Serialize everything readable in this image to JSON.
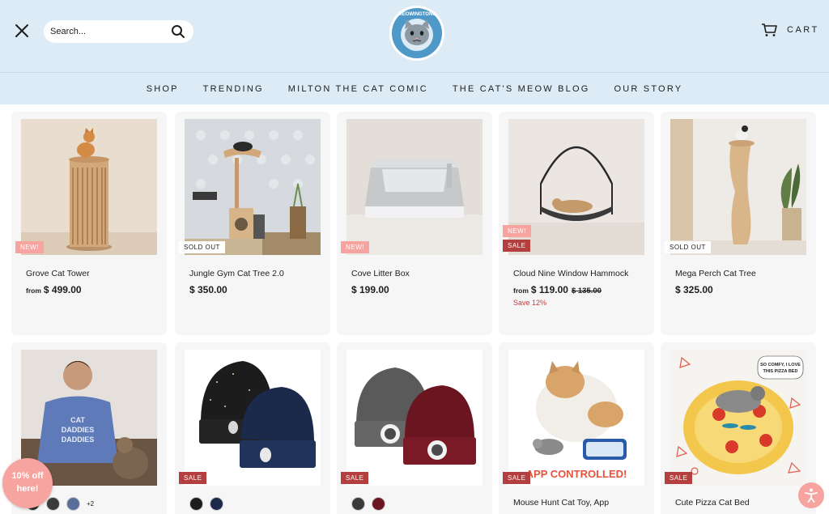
{
  "header": {
    "search_placeholder": "Search...",
    "cart_label": "CART",
    "logo_text": "MEOWINGTONS"
  },
  "nav": {
    "items": [
      "SHOP",
      "TRENDING",
      "MILTON THE CAT COMIC",
      "THE CAT'S MEOW BLOG",
      "OUR STORY"
    ]
  },
  "products": [
    {
      "title": "Grove Cat Tower",
      "from": "from",
      "price": "$ 499.00",
      "badges": [
        "NEW!"
      ]
    },
    {
      "title": "Jungle Gym Cat Tree 2.0",
      "from": "",
      "price": "$ 350.00",
      "badges": [
        "SOLD OUT"
      ]
    },
    {
      "title": "Cove Litter Box",
      "from": "",
      "price": "$ 199.00",
      "badges": [
        "NEW!"
      ]
    },
    {
      "title": "Cloud Nine Window Hammock",
      "from": "from",
      "price": "$ 119.00",
      "compare": "$ 135.00",
      "save": "Save 12%",
      "badges": [
        "NEW!",
        "SALE"
      ]
    },
    {
      "title": "Mega Perch Cat Tree",
      "from": "",
      "price": "$ 325.00",
      "badges": [
        "SOLD OUT"
      ]
    },
    {
      "title": "",
      "badges": [],
      "swatches": [
        "#2a2a2a",
        "#3b3b3b",
        "#5a6e9a"
      ],
      "swatch_more": "+2"
    },
    {
      "title": "",
      "badges": [
        "SALE"
      ],
      "swatches": [
        "#1d1d1d",
        "#1b2a4a"
      ]
    },
    {
      "title": "",
      "badges": [
        "SALE"
      ],
      "swatches": [
        "#3a3a3a",
        "#6a1520"
      ]
    },
    {
      "title": "Mouse Hunt Cat Toy, App",
      "badges": [
        "SALE"
      ],
      "image_caption": "APP CONTROLLED!"
    },
    {
      "title": "Cute Pizza Cat Bed",
      "badges": [
        "SALE"
      ],
      "image_caption": "SO COMFY, I LOVE THIS PIZZA BED"
    }
  ],
  "promo": {
    "text": "10% off here!"
  },
  "colors": {
    "header_bg": "#dcebf5",
    "card_bg": "#f6f6f6",
    "sale": "#b33f3f",
    "new": "#f7a4a0"
  }
}
